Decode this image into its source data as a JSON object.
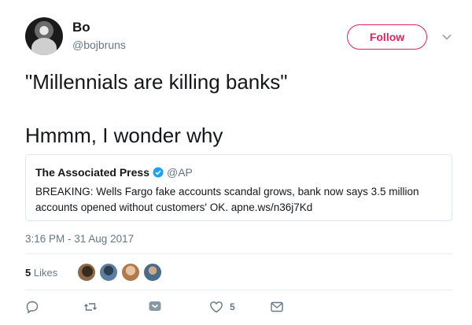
{
  "author": {
    "name": "Bo",
    "handle": "@bojbruns"
  },
  "follow_label": "Follow",
  "tweet": {
    "line1": "\"Millennials are killing banks\"",
    "line2": "Hmmm, I wonder why"
  },
  "quoted": {
    "name": "The Associated Press",
    "handle": "@AP",
    "text": "BREAKING: Wells Fargo fake accounts scandal grows, bank now says 3.5 million accounts opened without customers' OK. apne.ws/n36j7Kd"
  },
  "timestamp": "3:16 PM - 31 Aug 2017",
  "likes": {
    "count": "5",
    "label": "Likes"
  },
  "actions": {
    "like_count": "5"
  },
  "colors": {
    "accent": "#e0245e",
    "muted": "#657786",
    "verified": "#1da1f2"
  },
  "icons": [
    "reply-icon",
    "retweet-icon",
    "heart-icon",
    "mail-icon",
    "verified-icon",
    "chevron-down-icon"
  ]
}
